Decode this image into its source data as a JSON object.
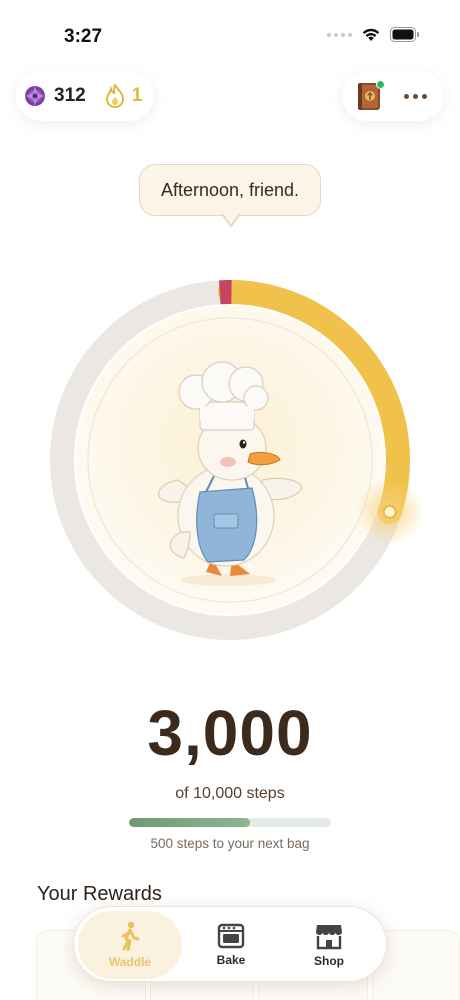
{
  "status_bar": {
    "time": "3:27"
  },
  "header": {
    "gems": "312",
    "streak": "1"
  },
  "greeting": "Afternoon, friend.",
  "steps": {
    "current": "3,000",
    "goal_text": "of 10,000 steps",
    "bag_progress": 0.6,
    "ring_progress": 0.3,
    "next_text": "500 steps to your next bag"
  },
  "rewards": {
    "title": "Your Rewards"
  },
  "tabs": [
    {
      "label": "Waddle",
      "icon": "walking-person-icon",
      "active": true
    },
    {
      "label": "Bake",
      "icon": "oven-icon",
      "active": false
    },
    {
      "label": "Shop",
      "icon": "storefront-icon",
      "active": false
    }
  ],
  "colors": {
    "ring_progress": "#f0c24b",
    "ring_track": "#ece8e4",
    "ring_start_marker": "#c9445e",
    "progress_bar": "#7ea583",
    "streak": "#e2b83c"
  }
}
